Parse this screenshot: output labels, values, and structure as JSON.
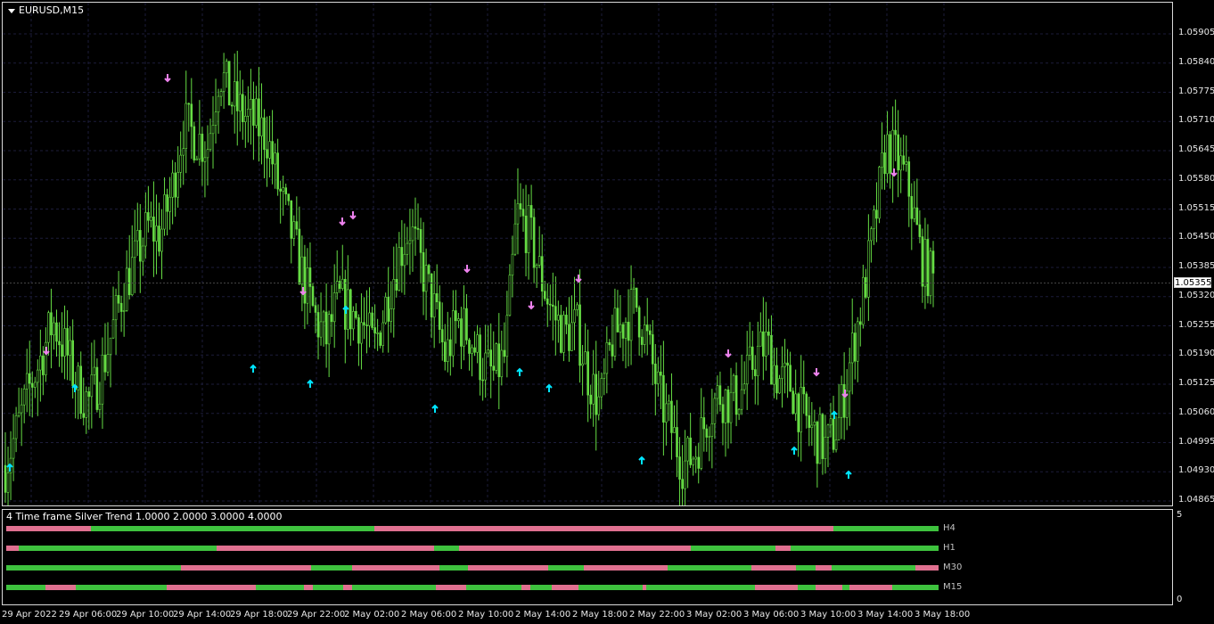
{
  "chart": {
    "symbol_label": "EURUSD,M15",
    "symbol_menu_icon": "triangle-down-icon",
    "candle_color": "#66dd44",
    "background": "#000000",
    "grid_color": "#1c1c3a",
    "price_scale": [
      "1.05905",
      "1.05840",
      "1.05775",
      "1.05710",
      "1.05645",
      "1.05580",
      "1.05515",
      "1.05450",
      "1.05385",
      "1.05320",
      "1.05255",
      "1.05190",
      "1.05125",
      "1.05060",
      "1.04995",
      "1.04930",
      "1.04865"
    ],
    "current_price": "1.05355",
    "time_scale": [
      "29 Apr 2022",
      "29 Apr 06:00",
      "29 Apr 10:00",
      "29 Apr 14:00",
      "29 Apr 18:00",
      "29 Apr 22:00",
      "2 May 02:00",
      "2 May 06:00",
      "2 May 10:00",
      "2 May 14:00",
      "2 May 18:00",
      "2 May 22:00",
      "3 May 02:00",
      "3 May 06:00",
      "3 May 10:00",
      "3 May 14:00",
      "3 May 18:00"
    ]
  },
  "chart_data": {
    "type": "candlestick",
    "title": "EURUSD,M15",
    "ylim": [
      1.04865,
      1.0597
    ],
    "close_path": [
      1.0495,
      1.0503,
      1.0512,
      1.0519,
      1.0527,
      1.0521,
      1.0513,
      1.0509,
      1.0515,
      1.0525,
      1.0535,
      1.0541,
      1.0548,
      1.0546,
      1.0556,
      1.0571,
      1.0568,
      1.0566,
      1.0583,
      1.0576,
      1.0573,
      1.0571,
      1.0568,
      1.0556,
      1.0547,
      1.0537,
      1.0528,
      1.0523,
      1.0532,
      1.0529,
      1.0527,
      1.0521,
      1.0531,
      1.0541,
      1.0548,
      1.0539,
      1.053,
      1.0519,
      1.0527,
      1.0524,
      1.0518,
      1.0515,
      1.0519,
      1.0551,
      1.0547,
      1.0537,
      1.0529,
      1.0524,
      1.0526,
      1.0515,
      1.0508,
      1.0523,
      1.0527,
      1.0531,
      1.0522,
      1.051,
      1.0503,
      1.0495,
      1.0498,
      1.0506,
      1.0511,
      1.0509,
      1.0512,
      1.0519,
      1.0522,
      1.0514,
      1.0513,
      1.0506,
      1.0502,
      1.0499,
      1.0504,
      1.0518,
      1.0531,
      1.0547,
      1.0566,
      1.0563,
      1.0556,
      1.0541,
      1.0536
    ],
    "buy_arrow_color": "#00e5ff",
    "sell_arrow_color": "#ee82ee"
  },
  "indicator": {
    "title": "4 Time frame Silver Trend 1.0000 2.0000 3.0000 4.0000",
    "scale_top": "5",
    "scale_bottom": "0",
    "up_color": "#3ec23e",
    "down_color": "#e07090",
    "rows": [
      {
        "label": "H4",
        "segments": [
          [
            "d",
            0,
            95
          ],
          [
            "u",
            95,
            413
          ],
          [
            "d",
            413,
            928
          ],
          [
            "u",
            928,
            1046
          ]
        ]
      },
      {
        "label": "H1",
        "segments": [
          [
            "d",
            0,
            14
          ],
          [
            "u",
            14,
            236
          ],
          [
            "d",
            236,
            480
          ],
          [
            "u",
            480,
            508
          ],
          [
            "d",
            508,
            768
          ],
          [
            "u",
            768,
            863
          ],
          [
            "d",
            863,
            880
          ],
          [
            "u",
            880,
            1046
          ]
        ]
      },
      {
        "label": "M30",
        "segments": [
          [
            "u",
            0,
            196
          ],
          [
            "d",
            196,
            342
          ],
          [
            "u",
            342,
            388
          ],
          [
            "d",
            388,
            486
          ],
          [
            "u",
            486,
            518
          ],
          [
            "d",
            518,
            608
          ],
          [
            "u",
            608,
            648
          ],
          [
            "d",
            648,
            742
          ],
          [
            "u",
            742,
            836
          ],
          [
            "d",
            836,
            886
          ],
          [
            "u",
            886,
            908
          ],
          [
            "d",
            908,
            926
          ],
          [
            "u",
            926,
            1020
          ],
          [
            "d",
            1020,
            1046
          ]
        ]
      },
      {
        "label": "M15",
        "segments": [
          [
            "u",
            0,
            44
          ],
          [
            "d",
            44,
            78
          ],
          [
            "u",
            78,
            180
          ],
          [
            "d",
            180,
            280
          ],
          [
            "u",
            280,
            334
          ],
          [
            "d",
            334,
            344
          ],
          [
            "u",
            344,
            378
          ],
          [
            "d",
            378,
            388
          ],
          [
            "u",
            388,
            482
          ],
          [
            "d",
            482,
            516
          ],
          [
            "u",
            516,
            578
          ],
          [
            "d",
            578,
            588
          ],
          [
            "u",
            588,
            612
          ],
          [
            "d",
            612,
            642
          ],
          [
            "u",
            642,
            714
          ],
          [
            "d",
            714,
            718
          ],
          [
            "u",
            718,
            840
          ],
          [
            "d",
            840,
            888
          ],
          [
            "u",
            888,
            908
          ],
          [
            "d",
            908,
            938
          ],
          [
            "u",
            938,
            946
          ],
          [
            "d",
            946,
            994
          ],
          [
            "u",
            994,
            1046
          ]
        ]
      }
    ]
  }
}
